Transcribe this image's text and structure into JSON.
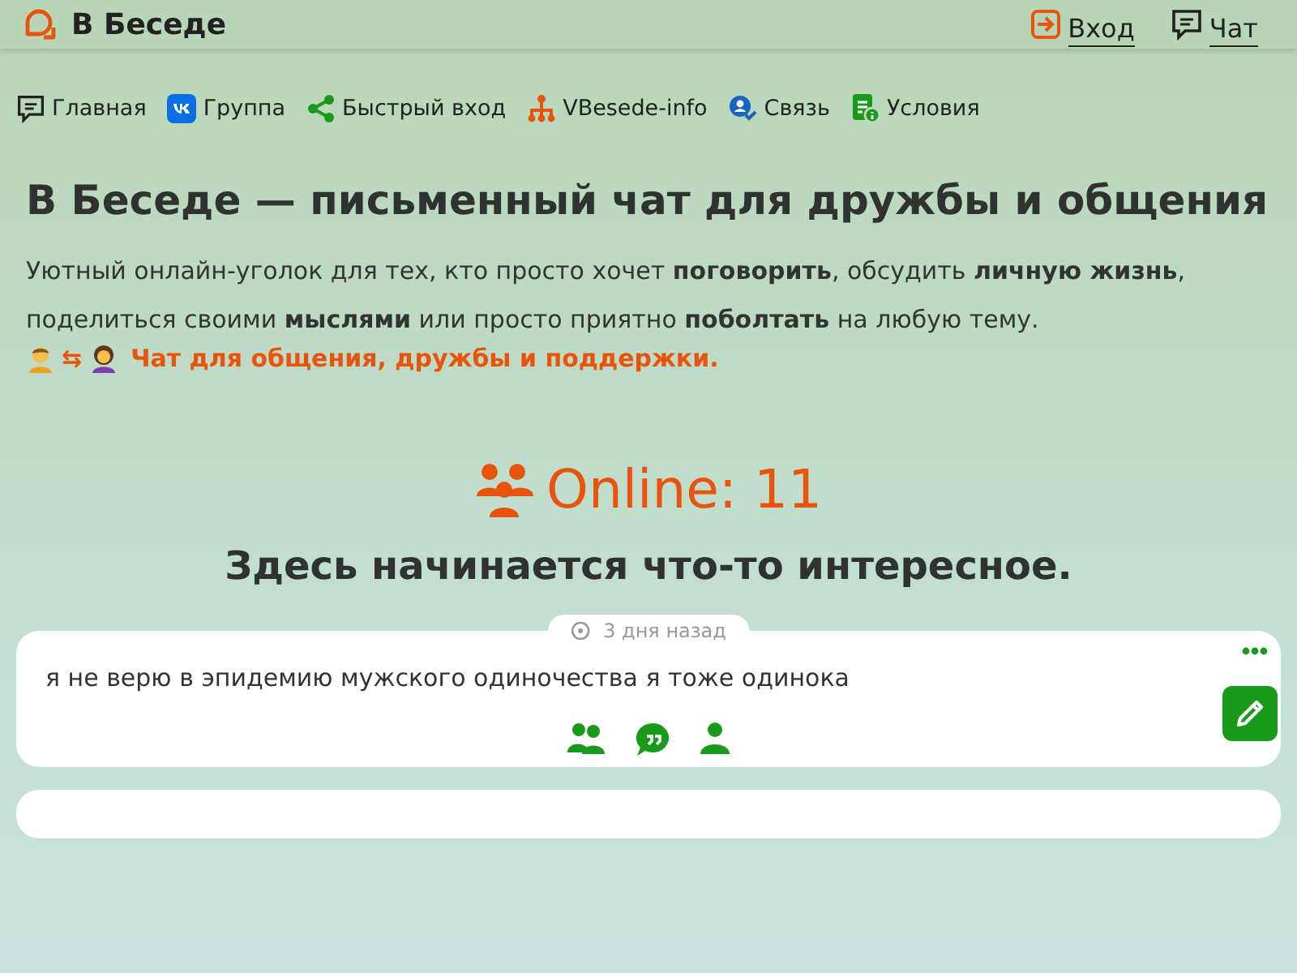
{
  "header": {
    "brand": "В Беседе",
    "links": [
      {
        "label": "Вход",
        "kind": "login"
      },
      {
        "label": "Чат",
        "kind": "chat"
      }
    ]
  },
  "nav": [
    {
      "label": "Главная",
      "kind": "chat"
    },
    {
      "label": "Группа",
      "kind": "vk"
    },
    {
      "label": "Быстрый вход",
      "kind": "share"
    },
    {
      "label": "VBesede-info",
      "kind": "tree"
    },
    {
      "label": "Связь",
      "kind": "contact"
    },
    {
      "label": "Условия",
      "kind": "doc"
    }
  ],
  "hero": {
    "title": "В Беседе — письменный чат для дружбы и общения",
    "text": "Уютный онлайн-уголок для тех, кто просто хочет **поговорить**, обсудить **личную жизнь**, поделиться своими **мыслями** или просто приятно **поболтать** на любую тему.",
    "swap": "⇆",
    "tagline": "Чат для общения, дружбы и поддержки."
  },
  "online": {
    "label": "Online: 11",
    "subtitle": "Здесь начинается что-то интересное."
  },
  "posts": [
    {
      "time": "3 дня назад",
      "text": "я не верю в эпидемию мужского одиночества я тоже одинока"
    }
  ]
}
